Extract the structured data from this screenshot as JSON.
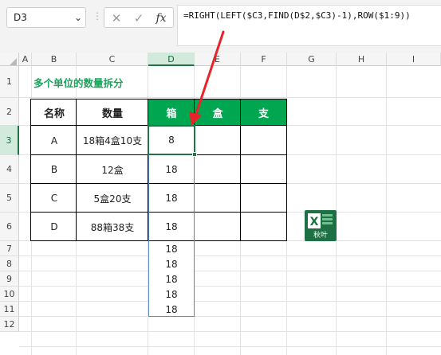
{
  "formula_bar": {
    "name_box": "D3",
    "cancel_glyph": "✕",
    "enter_glyph": "✓",
    "fx_label": "fx",
    "formula": "=RIGHT(LEFT($C3,FIND(D$2,$C3)-1),ROW($1:9))"
  },
  "columns": [
    "A",
    "B",
    "C",
    "D",
    "E",
    "F",
    "G",
    "H",
    "I"
  ],
  "rows": [
    "1",
    "2",
    "3",
    "4",
    "5",
    "6",
    "7",
    "8",
    "9",
    "10",
    "11",
    "12"
  ],
  "sheet": {
    "title": "多个单位的数量拆分",
    "headers": [
      "名称",
      "数量",
      "箱",
      "盒",
      "支"
    ],
    "data_rows": [
      {
        "name": "A",
        "qty": "18箱4盒10支",
        "box": "8"
      },
      {
        "name": "B",
        "qty": "12盒",
        "box": "18"
      },
      {
        "name": "C",
        "qty": "5盒20支",
        "box": "18"
      },
      {
        "name": "D",
        "qty": "88箱38支",
        "box": "18"
      }
    ],
    "spill_values": [
      "18",
      "18",
      "18",
      "18",
      "18"
    ]
  },
  "logo": {
    "text": "秋叶",
    "icon": "excel-x-icon",
    "color": "#1d7044"
  },
  "colors": {
    "accent": "#00a650",
    "title_green": "#1aa35b",
    "arrow": "#e8242a",
    "selection": "#217346"
  }
}
